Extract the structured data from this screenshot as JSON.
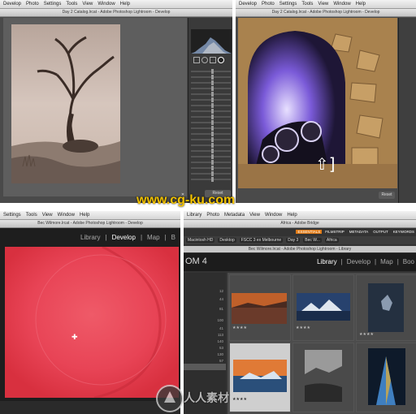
{
  "top_left": {
    "menu": [
      "Develop",
      "Photo",
      "Settings",
      "Tools",
      "View",
      "Window",
      "Help"
    ],
    "window_title": "Day 2 Catalog.lrcat - Adobe Photoshop Lightroom - Develop",
    "reset_label": "Reset"
  },
  "top_right": {
    "menu": [
      "Develop",
      "Photo",
      "Settings",
      "Tools",
      "View",
      "Window",
      "Help"
    ],
    "window_title": "Day 2 Catalog.lrcat - Adobe Photoshop Lightroom - Develop",
    "reset_label": "Reset"
  },
  "bottom_left": {
    "menu": [
      "Settings",
      "Tools",
      "View",
      "Window",
      "Help"
    ],
    "window_title": "Bec Wilmore.lrcat - Adobe Photoshop Lightroom - Develop",
    "modules": [
      "Library",
      "Develop",
      "Map",
      "B"
    ]
  },
  "bottom_right": {
    "menu": [
      "Library",
      "Photo",
      "Metadata",
      "View",
      "Window",
      "Help"
    ],
    "window_title": "Bec Wilmore.lrcat - Adobe Photoshop Lightroom - Library",
    "bridge_title": "Africa - Adobe Bridge",
    "bridge_tabs": [
      "ESSENTIALS",
      "FILMSTRIP",
      "METADATA",
      "OUTPUT",
      "KEYWORDS"
    ],
    "app_label": "OM 4",
    "modules": [
      "Library",
      "Develop",
      "Map",
      "Boo"
    ],
    "path": [
      "Macintosh HD",
      "Desktop",
      "FSCC 3 ex Melbourne",
      "Day 3",
      "Bec W...",
      "Africa"
    ],
    "left_panel_numbers": [
      "12",
      "44",
      "81",
      "100",
      "41",
      "113",
      "140",
      "53",
      "130",
      "57",
      "140"
    ]
  },
  "watermarks": {
    "site": "www.cg-ku.com",
    "cn": "人人素材"
  },
  "colors": {
    "watermark_yellow": "#f2c200",
    "lr_dark": "#2b2b2b",
    "red_photo": "#e8475a",
    "bridge_orange": "#e07a16"
  }
}
